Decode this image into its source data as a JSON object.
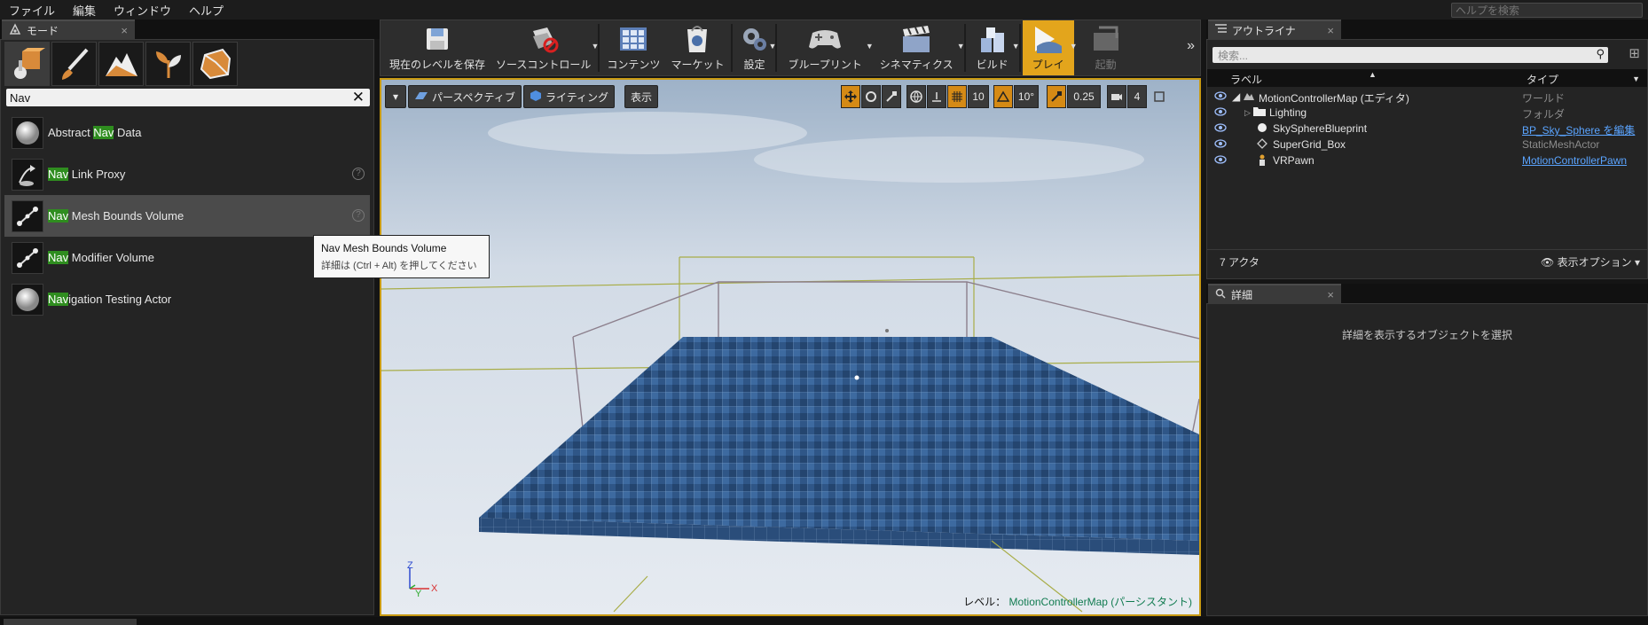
{
  "menu": [
    "ファイル",
    "編集",
    "ウィンドウ",
    "ヘルプ"
  ],
  "help_search_placeholder": "ヘルプを検索",
  "modes": {
    "tab_label": "モード",
    "search_value": "Nav",
    "results": [
      {
        "pre": "Abstract ",
        "hl": "Nav",
        "post": " Data"
      },
      {
        "pre": "",
        "hl": "Nav",
        "post": " Link Proxy"
      },
      {
        "pre": "",
        "hl": "Nav",
        "post": " Mesh Bounds Volume"
      },
      {
        "pre": "",
        "hl": "Nav",
        "post": " Modifier Volume"
      },
      {
        "pre": "",
        "hl": "Nav",
        "post": "igation Testing Actor"
      }
    ],
    "help_mark": "?"
  },
  "tooltip": {
    "title": "Nav Mesh Bounds Volume",
    "hint": "詳細は (Ctrl + Alt) を押してください"
  },
  "toolbar": {
    "save": "現在のレベルを保存",
    "source_control": "ソースコントロール",
    "content": "コンテンツ",
    "market": "マーケット",
    "settings": "設定",
    "blueprints": "ブループリント",
    "cinematics": "シネマティクス",
    "build": "ビルド",
    "play": "プレイ",
    "launch": "起動"
  },
  "viewport": {
    "perspective": "パースペクティブ",
    "lighting": "ライティング",
    "show": "表示",
    "grid_snap": "10",
    "rot_snap": "10°",
    "scale_snap": "0.25",
    "cam_speed": "4",
    "level_prefix": "レベル：",
    "level_name": "MotionControllerMap (パーシスタント)",
    "axis_z": "Z",
    "axis_x": "X",
    "axis_y": "Y"
  },
  "outliner": {
    "tab_label": "アウトライナ",
    "search_placeholder": "検索...",
    "col_label": "ラベル",
    "col_type": "タイプ",
    "rows": [
      {
        "label": "MotionControllerMap (エディタ)",
        "type": "ワールド",
        "link": false
      },
      {
        "label": "Lighting",
        "type": "フォルダ",
        "link": false
      },
      {
        "label": "SkySphereBlueprint",
        "type": "BP_Sky_Sphere を編集",
        "link": true
      },
      {
        "label": "SuperGrid_Box",
        "type": "StaticMeshActor",
        "link": false
      },
      {
        "label": "VRPawn",
        "type": "MotionControllerPawn",
        "link": true
      }
    ],
    "actor_count": "7 アクタ",
    "view_options": "表示オプション"
  },
  "details": {
    "tab_label": "詳細",
    "empty_message": "詳細を表示するオブジェクトを選択"
  },
  "colors": {
    "highlight": "#2f8d1f",
    "play_accent": "#e3a51c",
    "viewport_border": "#c89a12",
    "link": "#5aa4ff"
  }
}
